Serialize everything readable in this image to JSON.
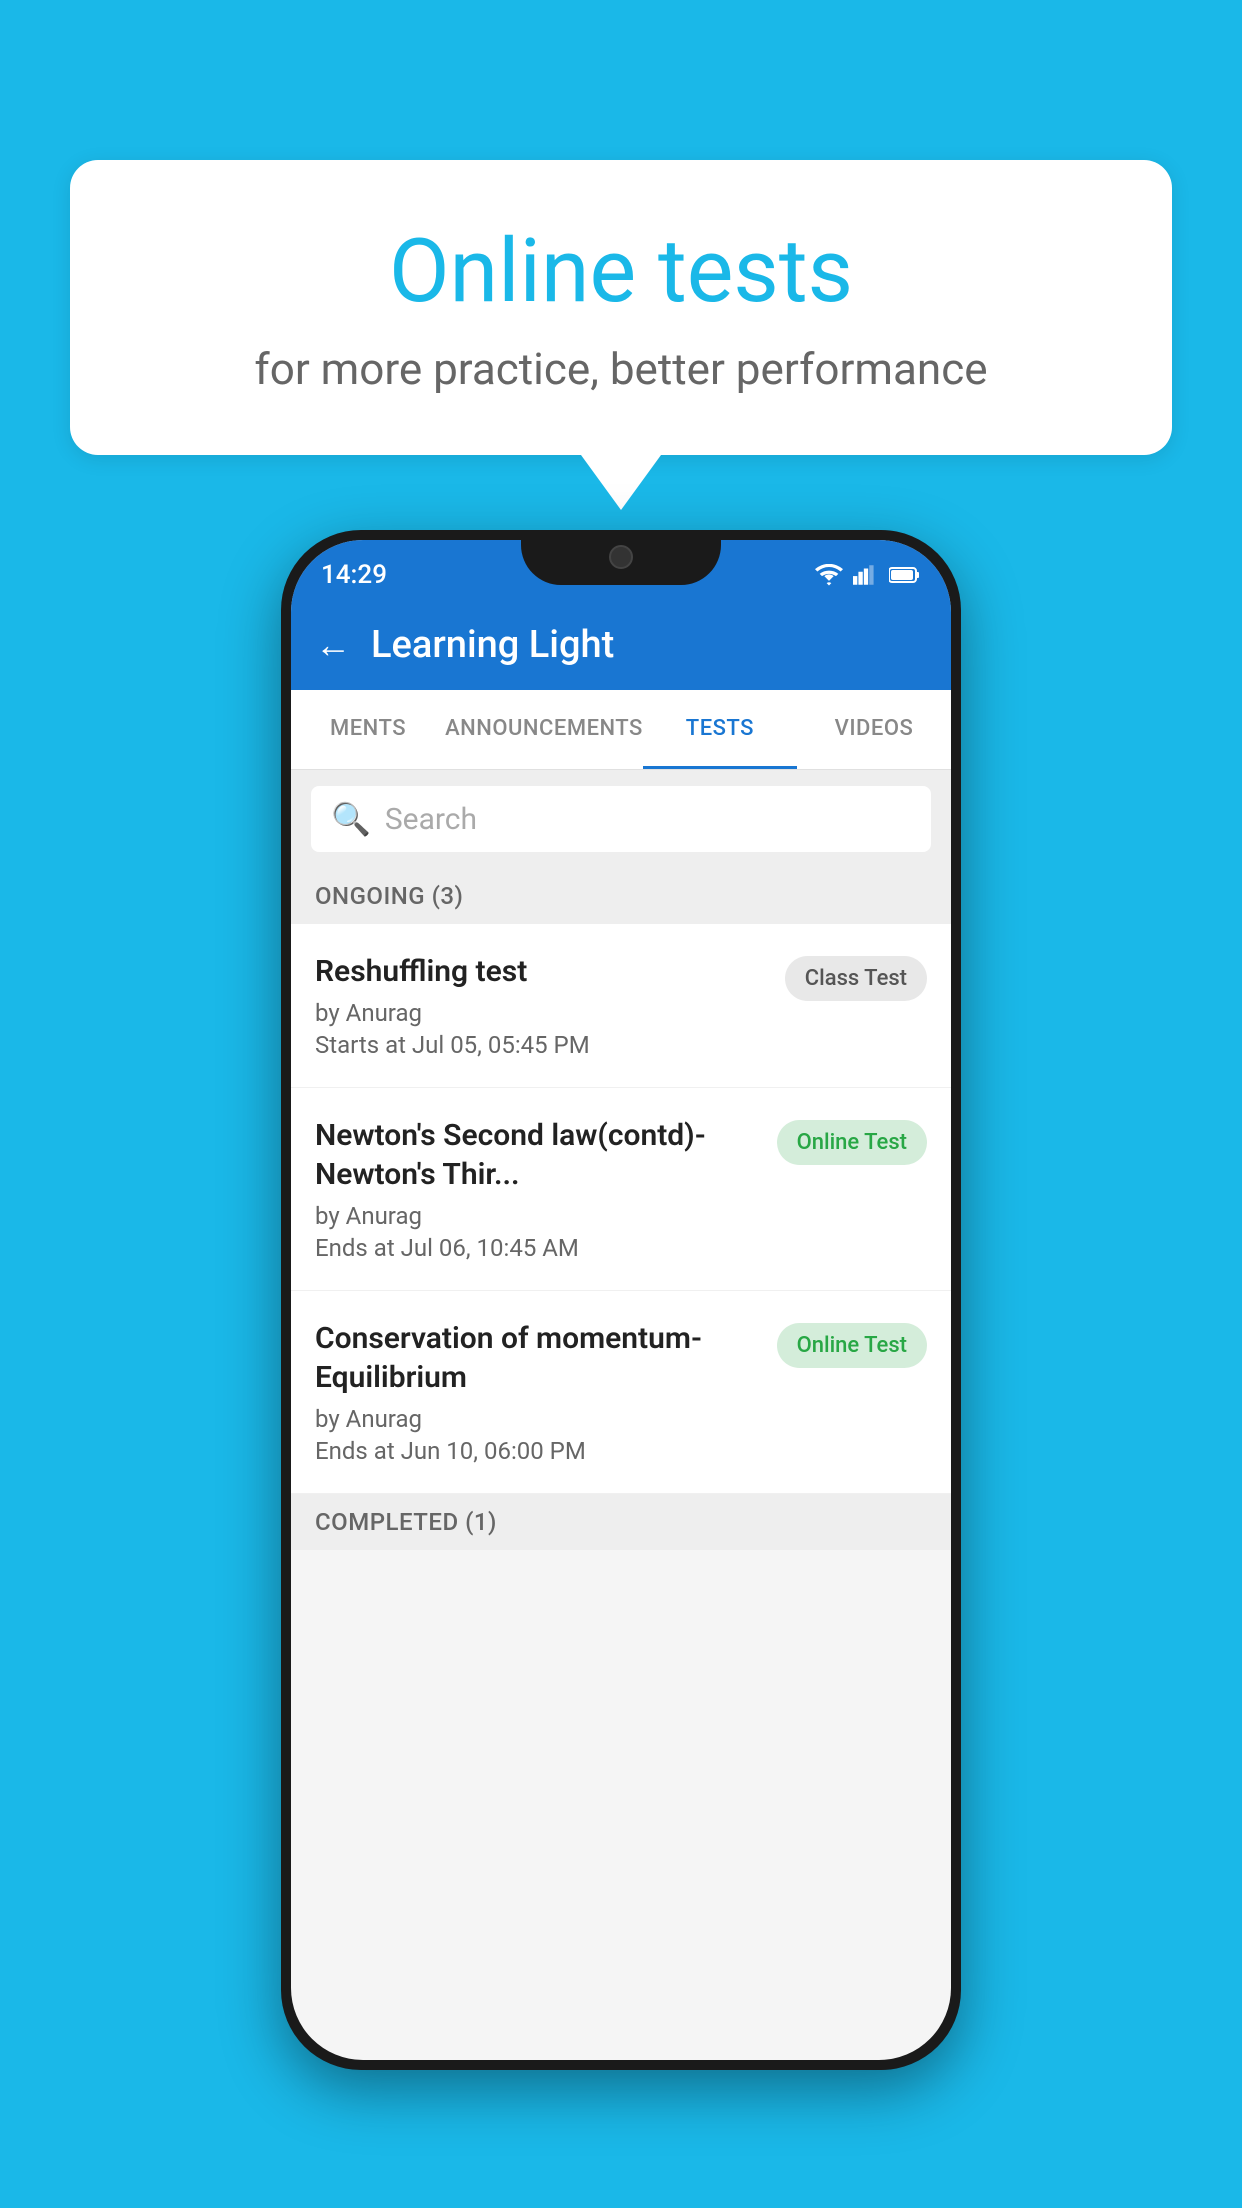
{
  "background": {
    "color": "#1ab8e8"
  },
  "speech_bubble": {
    "title": "Online tests",
    "subtitle": "for more practice, better performance"
  },
  "phone": {
    "status_bar": {
      "time": "14:29",
      "wifi_icon": "wifi-icon",
      "signal_icon": "signal-icon",
      "battery_icon": "battery-icon"
    },
    "app_bar": {
      "back_label": "←",
      "title": "Learning Light"
    },
    "tabs": [
      {
        "label": "MENTS",
        "active": false
      },
      {
        "label": "ANNOUNCEMENTS",
        "active": false
      },
      {
        "label": "TESTS",
        "active": true
      },
      {
        "label": "VIDEOS",
        "active": false
      }
    ],
    "search": {
      "placeholder": "Search"
    },
    "sections": [
      {
        "header": "ONGOING (3)",
        "items": [
          {
            "name": "Reshuffling test",
            "by": "by Anurag",
            "time": "Starts at  Jul 05, 05:45 PM",
            "badge": "Class Test",
            "badge_type": "class"
          },
          {
            "name": "Newton's Second law(contd)-Newton's Thir...",
            "by": "by Anurag",
            "time": "Ends at  Jul 06, 10:45 AM",
            "badge": "Online Test",
            "badge_type": "online"
          },
          {
            "name": "Conservation of momentum-Equilibrium",
            "by": "by Anurag",
            "time": "Ends at  Jun 10, 06:00 PM",
            "badge": "Online Test",
            "badge_type": "online"
          }
        ]
      }
    ],
    "completed_header": "COMPLETED (1)"
  }
}
